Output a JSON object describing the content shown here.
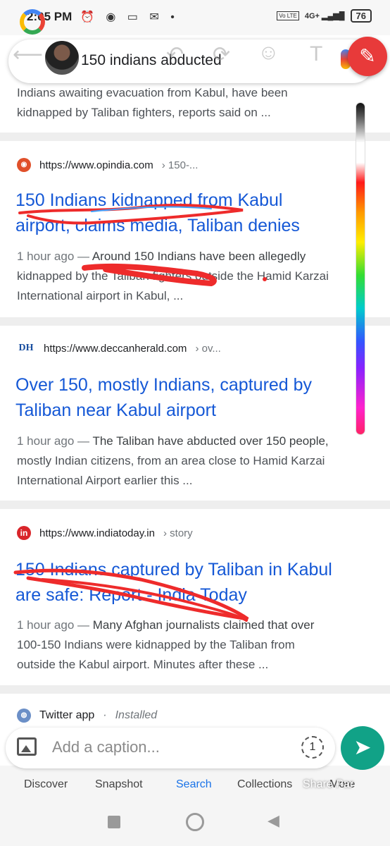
{
  "status_bar": {
    "time": "2:05 PM",
    "left_icons": "⏰ ◉ ▭ ✉ •",
    "volte": "Vo LTE",
    "signal": "4G+ ▂▄▆█",
    "battery": "76"
  },
  "search": {
    "query": "150 indians abducted"
  },
  "overlay_icons": {
    "back": "⟵",
    "undo": "↶",
    "crop": "⟳",
    "emoji": "☺",
    "text": "T",
    "edit": "✎"
  },
  "results": [
    {
      "snippet_top": "Indians awaiting evacuation from Kabul, have been",
      "snippet_line2": "kidnapped by Taliban fighters, reports said on ..."
    },
    {
      "url": "https://www.opindia.com",
      "crumb": "› 150-...",
      "title_line1": "150 Indians kidnapped from Kabul",
      "title_line2": "airport, claims media, Taliban denies",
      "age": "1 hour ago —",
      "snippet_line1": "Around 150 Indians have been allegedly",
      "snippet_line2": "kidnapped by the Taliban fighters outside the Hamid Karzai",
      "snippet_line3": "International airport in Kabul, ..."
    },
    {
      "url": "https://www.deccanherald.com",
      "crumb": "› ov...",
      "favicon": "DH",
      "title_line1": "Over 150, mostly Indians, captured by",
      "title_line2": "Taliban near Kabul airport",
      "age": "1 hour ago —",
      "snippet_line1": "The Taliban have abducted over 150 people,",
      "snippet_line2": "mostly Indian citizens, from an area close to Hamid Karzai",
      "snippet_line3": "International Airport earlier this ..."
    },
    {
      "url": "https://www.indiatoday.in",
      "crumb": "› story",
      "favicon": "in",
      "title_line1": "150 Indians captured by Taliban in Kabul",
      "title_line2": "are safe: Report - India Today",
      "age": "1 hour ago —",
      "snippet_line1": "Many Afghan journalists claimed that over",
      "snippet_line2": "100-150 Indians were kidnapped by the Taliban from",
      "snippet_line3": "outside the Kabul airport. Minutes after these ..."
    }
  ],
  "twitter": {
    "label": "Twitter app",
    "separator": "·",
    "status": "Installed"
  },
  "caption": {
    "placeholder": "Add a caption...",
    "timer": "1"
  },
  "bottom_nav": {
    "discover": "Discover",
    "snapshot": "Snapshot",
    "search": "Search",
    "collections": "Collections",
    "more": "More",
    "share": "Share Par"
  },
  "colors": {
    "link": "#1558d6",
    "accent_red": "#e83a3a",
    "send_green": "#11a287"
  }
}
